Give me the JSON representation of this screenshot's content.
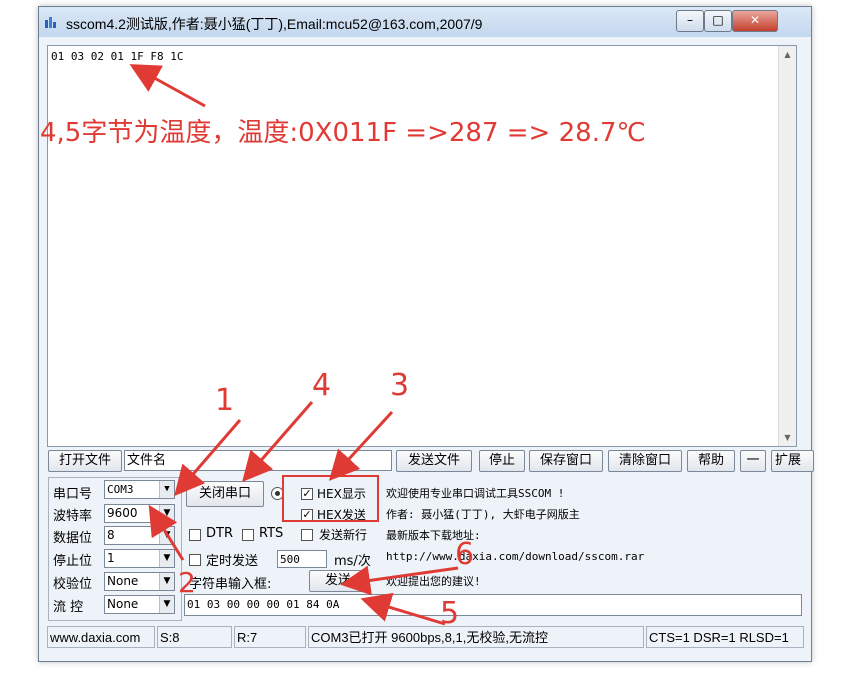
{
  "window": {
    "title": "sscom4.2测试版,作者:聂小猛(丁丁),Email:mcu52@163.com,2007/9",
    "controls": [
      "–",
      "□",
      "✕"
    ]
  },
  "receive": {
    "text": "01 03 02 01 1F F8 1C"
  },
  "annotations": {
    "main": "4,5字节为温度，温度:0X011F =>287 => 28.7℃",
    "n1": "1",
    "n2": "2",
    "n3": "3",
    "n4": "4",
    "n5": "5",
    "n6": "6"
  },
  "toolbar": {
    "open_file": "打开文件",
    "filename_placeholder": "文件名",
    "send_file": "发送文件",
    "stop": "停止",
    "save_window": "保存窗口",
    "clear_window": "清除窗口",
    "help": "帮助",
    "minus": "一",
    "expand": "扩展"
  },
  "port": {
    "port_label": "串口号",
    "port_value": "COM3",
    "baud_label": "波特率",
    "baud_value": "9600",
    "data_label": "数据位",
    "data_value": "8",
    "stop_label": "停止位",
    "stop_value": "1",
    "parity_label": "校验位",
    "parity_value": "None",
    "flow_label": "流 控",
    "flow_value": "None"
  },
  "controls": {
    "close_port": "关闭串口",
    "hex_display": "HEX显示",
    "hex_send": "HEX发送",
    "dtr": "DTR",
    "rts": "RTS",
    "send_newline": "发送新行",
    "timed_send": "定时发送",
    "interval": "500",
    "interval_unit": "ms/次",
    "input_label": "字符串输入框:",
    "send": "发送",
    "send_input": "01 03 00 00 00 01 84 0A"
  },
  "info": {
    "line1": "欢迎使用专业串口调试工具SSCOM !",
    "line2": "作者: 聂小猛(丁丁), 大虾电子网版主",
    "line3": "最新版本下载地址:",
    "line4": "http://www.daxia.com/download/sscom.rar",
    "line5": "欢迎提出您的建议!"
  },
  "status": {
    "site": "www.daxia.com",
    "s": "S:8",
    "r": "R:7",
    "port_state": "COM3已打开  9600bps,8,1,无校验,无流控",
    "lines": "CTS=1 DSR=1 RLSD=1"
  },
  "colors": {
    "annotation": "#e03a34",
    "title_bar": "#c3d7ee"
  }
}
